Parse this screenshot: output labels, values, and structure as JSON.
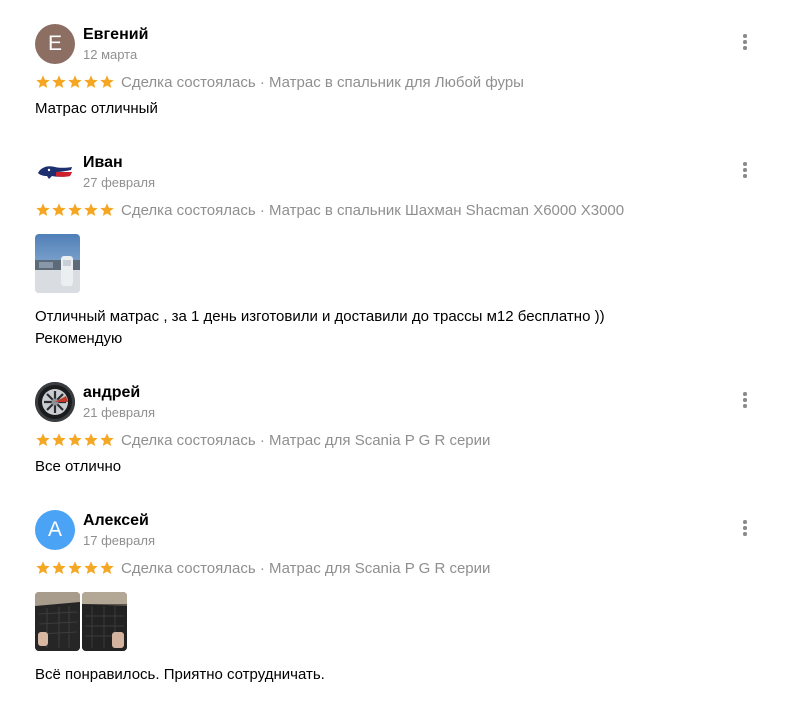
{
  "colors": {
    "star": "#f5a623",
    "secondary_text": "#8f8f8f",
    "menu_dots": "#8a8a8a"
  },
  "reviews": [
    {
      "name": "Евгений",
      "date": "12 марта",
      "avatar_letter": "Е",
      "avatar_color": "#8c6e63",
      "rating": 5,
      "deal": "Сделка состоялась · Матрас в спальник для Любой фуры",
      "text_lines": [
        "Матрас отличный"
      ]
    },
    {
      "name": "Иван",
      "date": "27 февраля",
      "avatar_icon": "lacoste-crocodile-logo",
      "rating": 5,
      "deal": "Сделка состоялась · Матрас в спальник Шахман Shacman X6000 X3000",
      "photos": [
        "winter-truck-photo"
      ],
      "text_lines": [
        "Отличный матрас , за 1 день изготовили и доставили до трассы м12 бесплатно ))",
        "Рекомендую"
      ]
    },
    {
      "name": "андрей",
      "date": "21 февраля",
      "avatar_icon": "car-wheel-rim-photo",
      "rating": 5,
      "deal": "Сделка состоялась · Матрас для Scania P G R серии",
      "text_lines": [
        "Все отлично"
      ]
    },
    {
      "name": "Алексей",
      "date": "17 февраля",
      "avatar_letter": "А",
      "avatar_color": "#4aa3f5",
      "rating": 5,
      "deal": "Сделка состоялась · Матрас для Scania P G R серии",
      "photos": [
        "mattress-photo-1",
        "mattress-photo-2"
      ],
      "text_lines": [
        "Всё понравилось. Приятно сотрудничать."
      ]
    }
  ]
}
